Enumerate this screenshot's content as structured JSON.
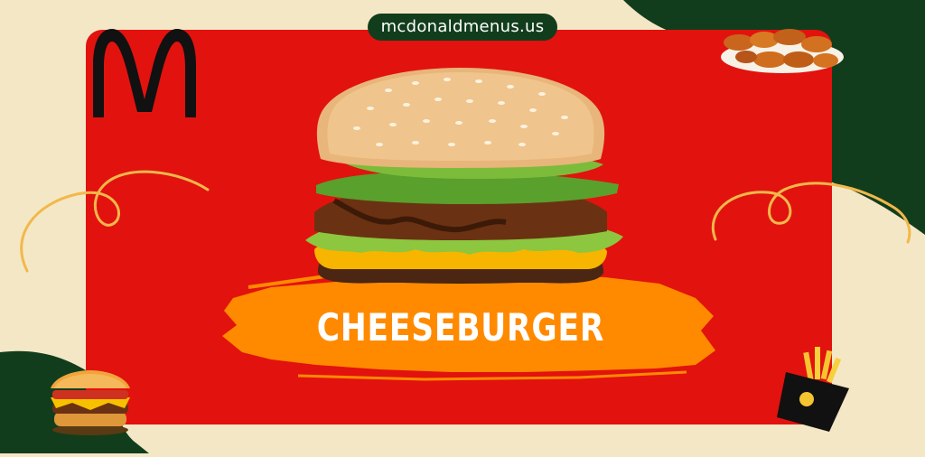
{
  "site": {
    "label": "mcdonaldmenus.us"
  },
  "banner": {
    "title": "CHEESEBURGER"
  },
  "colors": {
    "background": "#f4e7c6",
    "panel": "#e2120f",
    "dark_green": "#123d1c",
    "brush_orange": "#ff8a00",
    "logo_black": "#111111"
  },
  "icons": [
    "mcdonalds-arches-logo",
    "chicken-nuggets-image",
    "cheeseburger-photo",
    "burger-illustration-icon",
    "fries-icon"
  ]
}
